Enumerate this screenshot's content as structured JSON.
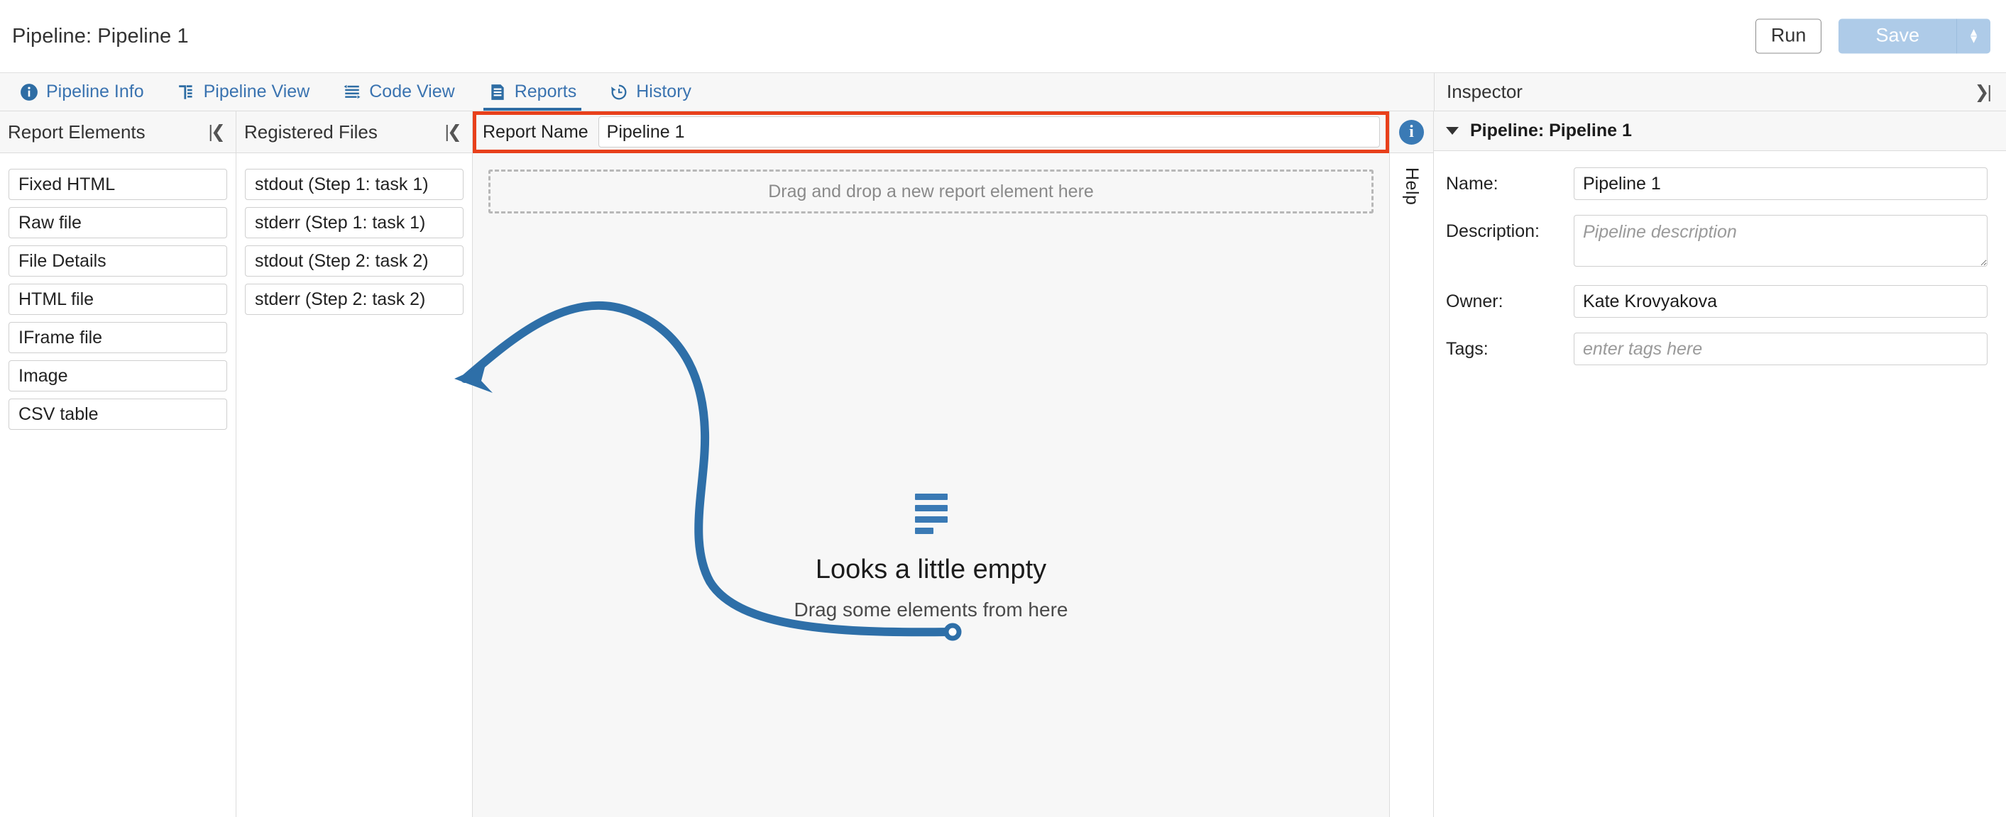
{
  "titlebar": {
    "title": "Pipeline: Pipeline 1",
    "run_label": "Run",
    "save_label": "Save",
    "save_caret_icon": "caret-updown-icon"
  },
  "tabs": [
    {
      "label": "Pipeline Info",
      "icon": "info-circle-icon",
      "active": false
    },
    {
      "label": "Pipeline View",
      "icon": "pipeline-tree-icon",
      "active": false
    },
    {
      "label": "Code View",
      "icon": "code-lines-icon",
      "active": false
    },
    {
      "label": "Reports",
      "icon": "document-lines-icon",
      "active": true
    },
    {
      "label": "History",
      "icon": "clock-rewind-icon",
      "active": false
    }
  ],
  "report_elements_panel": {
    "title": "Report Elements",
    "collapse_icon": "collapse-left-icon",
    "items": [
      {
        "label": "Fixed HTML"
      },
      {
        "label": "Raw file"
      },
      {
        "label": "File Details"
      },
      {
        "label": "HTML file"
      },
      {
        "label": "IFrame file"
      },
      {
        "label": "Image"
      },
      {
        "label": "CSV table"
      }
    ]
  },
  "registered_files_panel": {
    "title": "Registered Files",
    "collapse_icon": "collapse-left-icon",
    "items": [
      {
        "label": "stdout (Step 1: task 1)"
      },
      {
        "label": "stderr (Step 1: task 1)"
      },
      {
        "label": "stdout (Step 2: task 2)"
      },
      {
        "label": "stderr (Step 2: task 2)"
      }
    ]
  },
  "report_area": {
    "report_name_label": "Report Name",
    "report_name_value": "Pipeline 1",
    "dropzone_text": "Drag and drop a new report element here",
    "empty_title": "Looks a little empty",
    "empty_subtitle": "Drag some elements from here"
  },
  "help_rail": {
    "info_icon": "info-circle-icon",
    "info_glyph": "i",
    "help_label": "Help"
  },
  "inspector": {
    "title": "Inspector",
    "collapse_icon": "collapse-right-icon",
    "section_title": "Pipeline: Pipeline 1",
    "fields": [
      {
        "label": "Name:",
        "value": "Pipeline 1",
        "placeholder": "",
        "type": "text"
      },
      {
        "label": "Description:",
        "value": "",
        "placeholder": "Pipeline description",
        "type": "textarea"
      },
      {
        "label": "Owner:",
        "value": "Kate Krovyakova",
        "placeholder": "",
        "type": "text"
      },
      {
        "label": "Tags:",
        "value": "",
        "placeholder": "enter tags here",
        "type": "text"
      }
    ]
  },
  "annotations": {
    "highlight_box_color": "#e8401b",
    "arrow_color": "#2e6fa8",
    "arrow_label": "",
    "accent_blue": "#3a7ab5"
  }
}
